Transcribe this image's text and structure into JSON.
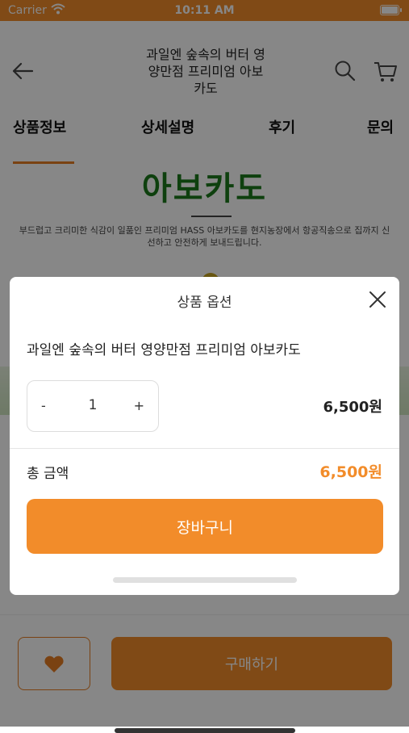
{
  "status_bar": {
    "carrier": "Carrier",
    "time": "10:11 AM"
  },
  "header": {
    "title": "과일엔 숲속의 버터 영양만점 프리미엄 아보카도"
  },
  "tabs": [
    {
      "label": "상품정보"
    },
    {
      "label": "상세설명"
    },
    {
      "label": "후기"
    },
    {
      "label": "문의"
    }
  ],
  "product": {
    "heading": "아보카도",
    "description": "부드럽고 크리미한 식감이 일품인 프리미엄 HASS 아보카도를 현지농장에서 항공직송으로 집까지 신선하고 안전하게 보내드립니다."
  },
  "bottom_bar": {
    "buy_label": "구매하기"
  },
  "modal": {
    "title": "상품 옵션",
    "product_name": "과일엔 숲속의 버터 영양만점 프리미엄 아보카도",
    "stepper": {
      "minus": "-",
      "quantity": "1",
      "plus": "+"
    },
    "item_price": "6,500원",
    "total_label": "총 금액",
    "total_value": "6,500원",
    "cart_button": "장바구니"
  },
  "colors": {
    "accent": "#f28c2a",
    "heading_green": "#1b7a1b"
  }
}
